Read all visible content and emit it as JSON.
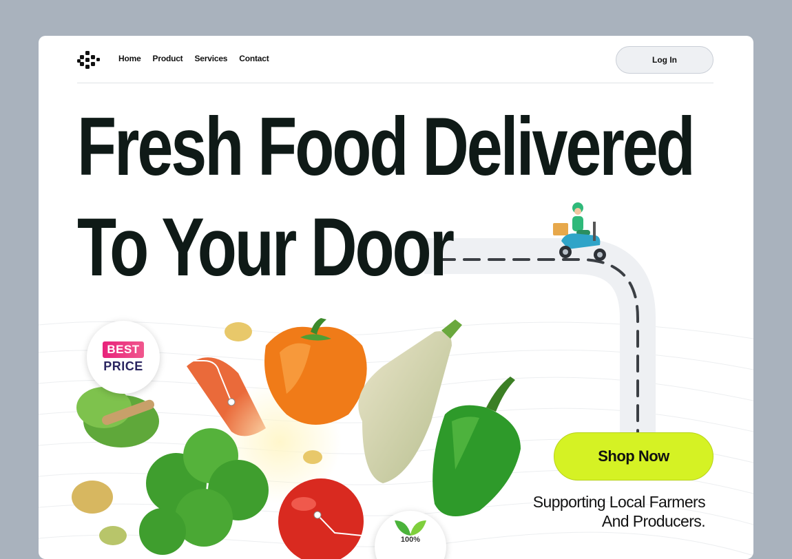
{
  "nav": {
    "logo_icon": "logo-dots-icon",
    "links": [
      "Home",
      "Product",
      "Services",
      "Contact"
    ],
    "login_label": "Log In"
  },
  "hero": {
    "headline_line1": "Fresh Food Delivered",
    "headline_line2": "To Your Door",
    "shop_label": "Shop Now",
    "tagline_line1": "Supporting Local Farmers",
    "tagline_line2": "And Producers."
  },
  "badges": {
    "best_top": "BEST",
    "best_bottom": "PRICE",
    "organic_icon": "leaf-icon",
    "organic_text": "100%"
  },
  "colors": {
    "background": "#a9b2bd",
    "card": "#ffffff",
    "headline": "#0f1a17",
    "accent": "#d5f224",
    "badge_pink": "#e8227b"
  }
}
